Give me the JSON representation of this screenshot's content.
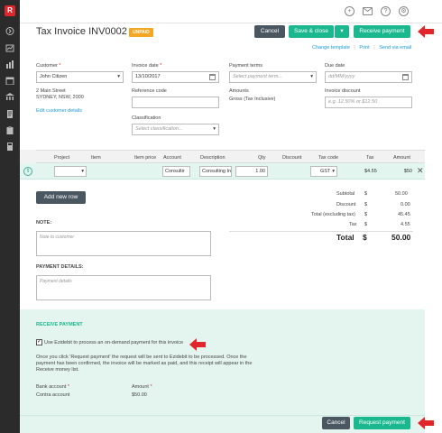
{
  "app": {
    "logo": "R"
  },
  "sidebar": {
    "icons": [
      "chevron-right-icon",
      "dashboard-icon",
      "chart-icon",
      "calendar-icon",
      "bank-icon",
      "document-icon",
      "clipboard-icon",
      "calculator-icon"
    ]
  },
  "topbar": {
    "icons": [
      "add-icon",
      "mail-icon",
      "help-icon",
      "settings-icon"
    ]
  },
  "header": {
    "title": "Tax Invoice INV0002",
    "status": "UNPAID",
    "help_glyph": "?"
  },
  "actions": {
    "cancel": "Cancel",
    "save_close": "Save & close",
    "dropdown_glyph": "▾",
    "receive_payment": "Receive payment"
  },
  "links": {
    "change_template": "Change template",
    "print": "Print",
    "send_via_email": "Send via email",
    "sep": "|"
  },
  "form": {
    "customer_label": "Customer",
    "customer_value": "John Citizen",
    "address_line1": "2 Main Street",
    "address_line2": "SYDNEY, NSW, 2000",
    "edit_customer": "Edit customer details",
    "invoice_date_label": "Invoice date",
    "invoice_date_value": "13/10/2017",
    "reference_label": "Reference code",
    "reference_value": "",
    "classification_label": "Classification",
    "classification_placeholder": "Select classification...",
    "payment_terms_label": "Payment terms",
    "payment_terms_placeholder": "Select payment term...",
    "amounts_label": "Amounts",
    "amounts_value": "Gross (Tax Inclusive)",
    "due_date_label": "Due date",
    "due_date_placeholder": "dd/MM/yyyy",
    "discount_label": "Invoice discount",
    "discount_placeholder": "e.g. 12.50% or $12.50"
  },
  "table": {
    "headers": [
      "Project",
      "Item",
      "Item price",
      "Account",
      "Description",
      "Qty",
      "Discount",
      "Tax code",
      "Tax",
      "Amount"
    ],
    "row": {
      "project": "",
      "item": "",
      "item_price": "",
      "account": "Consultir",
      "description": "Consulting In",
      "qty": "1.00",
      "discount": "",
      "tax_code": "GST",
      "tax": "$4.55",
      "amount": "$50"
    },
    "remove_glyph": "✕",
    "drag_glyph": "⇕"
  },
  "add_row": "Add new row",
  "totals": {
    "subtotal_label": "Subtotal",
    "subtotal": "50.00",
    "discount_label": "Discount",
    "discount": "0.00",
    "total_ex_label": "Total (excluding tax)",
    "total_ex": "45.45",
    "tax_label": "Tax",
    "tax": "4.55",
    "total_label": "Total",
    "total": "50.00",
    "currency": "$"
  },
  "note": {
    "label": "NOTE:",
    "placeholder": "Note to customer"
  },
  "payment_details": {
    "label": "PAYMENT DETAILS:",
    "placeholder": "Payment details"
  },
  "receive": {
    "heading": "RECEIVE PAYMENT",
    "checkbox_label": "Use Ezidebit to process an on-demand payment for this invoice",
    "checked": true,
    "info": "Once you click 'Request payment' the request will be sent to Ezidebit to be processed. Once the payment has been confirmed, the invoice will be marked as paid, and this receipt will appear in the Receive money list.",
    "bank_label": "Bank account",
    "bank_value": "Contra account",
    "amount_label": "Amount",
    "amount_value": "$50.00"
  },
  "footer": {
    "cancel": "Cancel",
    "request_payment": "Request payment"
  },
  "required_marker": "*",
  "colors": {
    "accent": "#1bb88f",
    "dark_button": "#4a5660",
    "badge": "#f5a623",
    "arrow": "#e0262a",
    "link": "#1a9bd7"
  }
}
